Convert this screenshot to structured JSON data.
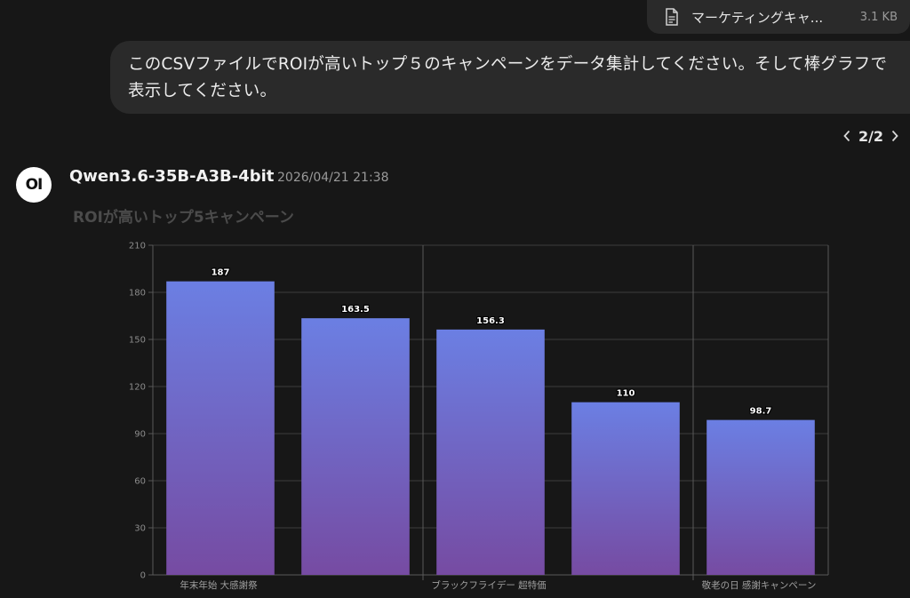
{
  "attachment": {
    "file_name": "マーケティングキャ...",
    "file_size": "3.1 KB",
    "icon": "document-icon"
  },
  "user_message": {
    "text": "このCSVファイルでROIが高いトップ５のキャンペーンをデータ集計してください。そして棒グラフで表示してください。"
  },
  "pager": {
    "label": "2/2",
    "prev_icon": "chevron-left-icon",
    "next_icon": "chevron-right-icon"
  },
  "assistant": {
    "avatar_text": "OI",
    "model": "Qwen3.6-35B-A3B-4bit",
    "timestamp": "2026/04/21 21:38"
  },
  "colors": {
    "background": "#171717",
    "bubble": "#2a2a2a",
    "bar_top": "#6b7fe3",
    "bar_bottom": "#764ba2"
  },
  "chart_data": {
    "type": "bar",
    "title": "ROIが高いトップ5キャンペーン",
    "categories": [
      "年末年始 大感謝祭",
      "",
      "ブラックフライデー 超特価",
      "",
      "敬老の日 感謝キャンペーン"
    ],
    "values": [
      187,
      163.5,
      156.3,
      110,
      98.7
    ],
    "value_labels": [
      "187",
      "163.5",
      "156.3",
      "110",
      "98.7"
    ],
    "ylim": [
      0,
      210
    ],
    "yticks": [
      "0",
      "30",
      "60",
      "90",
      "120",
      "150",
      "180",
      "210"
    ],
    "grid": true
  }
}
